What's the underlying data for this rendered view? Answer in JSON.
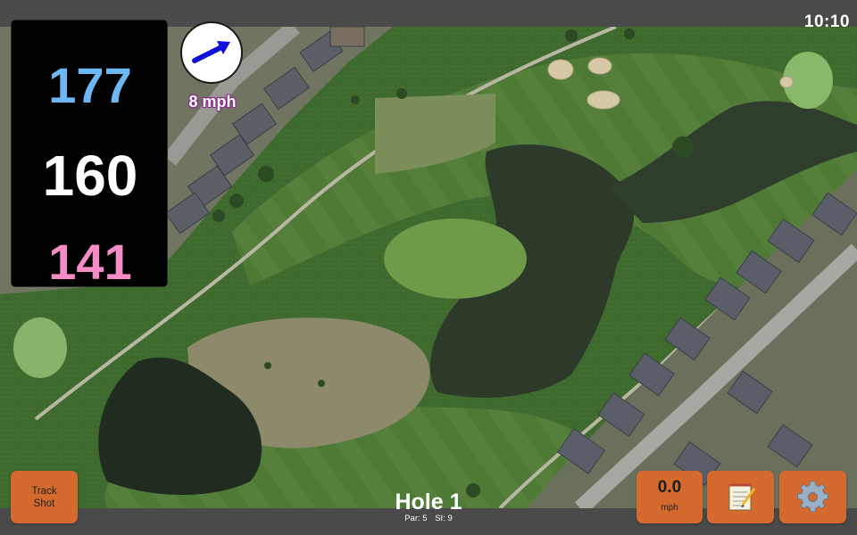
{
  "status": {
    "time": "10:10"
  },
  "distances": {
    "back": "177",
    "middle": "160",
    "front": "141"
  },
  "wind": {
    "speed_label": "8 mph",
    "direction_icon": "wind-arrow-icon"
  },
  "hole": {
    "title": "Hole 1",
    "par": "Par: 5",
    "si": "SI: 9"
  },
  "buttons": {
    "track_shot": "Track\nShot",
    "speed_value": "0.0",
    "speed_unit": "mph",
    "notes_icon": "notepad-icon",
    "settings_icon": "gear-icon"
  },
  "colors": {
    "back": "#6eb7f5",
    "middle": "#ffffff",
    "front": "#f58cc8",
    "wind_text_outline": "#8a2a8c",
    "button": "#d46a2e"
  }
}
